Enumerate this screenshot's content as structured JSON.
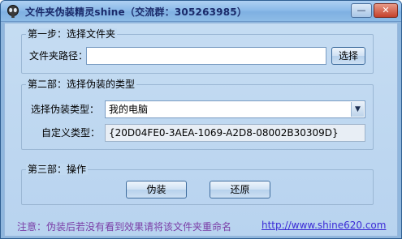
{
  "window": {
    "title": "文件夹伪装精灵shine（交流群：305263985）",
    "minimize_glyph": "—",
    "close_glyph": "✕"
  },
  "step1": {
    "legend": "第一步：选择文件夹",
    "path_label": "文件夹路径：",
    "path_value": "",
    "browse_button": "选择"
  },
  "step2": {
    "legend": "第二部：选择伪装的类型",
    "type_label": "选择伪装类型：",
    "type_value": "我的电脑",
    "custom_label": "自定义类型：",
    "custom_value": "{20D04FE0-3AEA-1069-A2D8-08002B30309D}"
  },
  "step3": {
    "legend": "第三部：操作",
    "disguise_button": "伪装",
    "restore_button": "还原"
  },
  "footer": {
    "note": "注意：伪装后若没有看到效果请将该文件夹重命名",
    "link": "http://www.shine620.com"
  },
  "colors": {
    "note": "#7b3fa7",
    "link": "#3b2ad6",
    "title": "#1a2a6a"
  },
  "icons": {
    "app": "alien-head-icon",
    "combo_arrow": "chevron-down-icon"
  }
}
